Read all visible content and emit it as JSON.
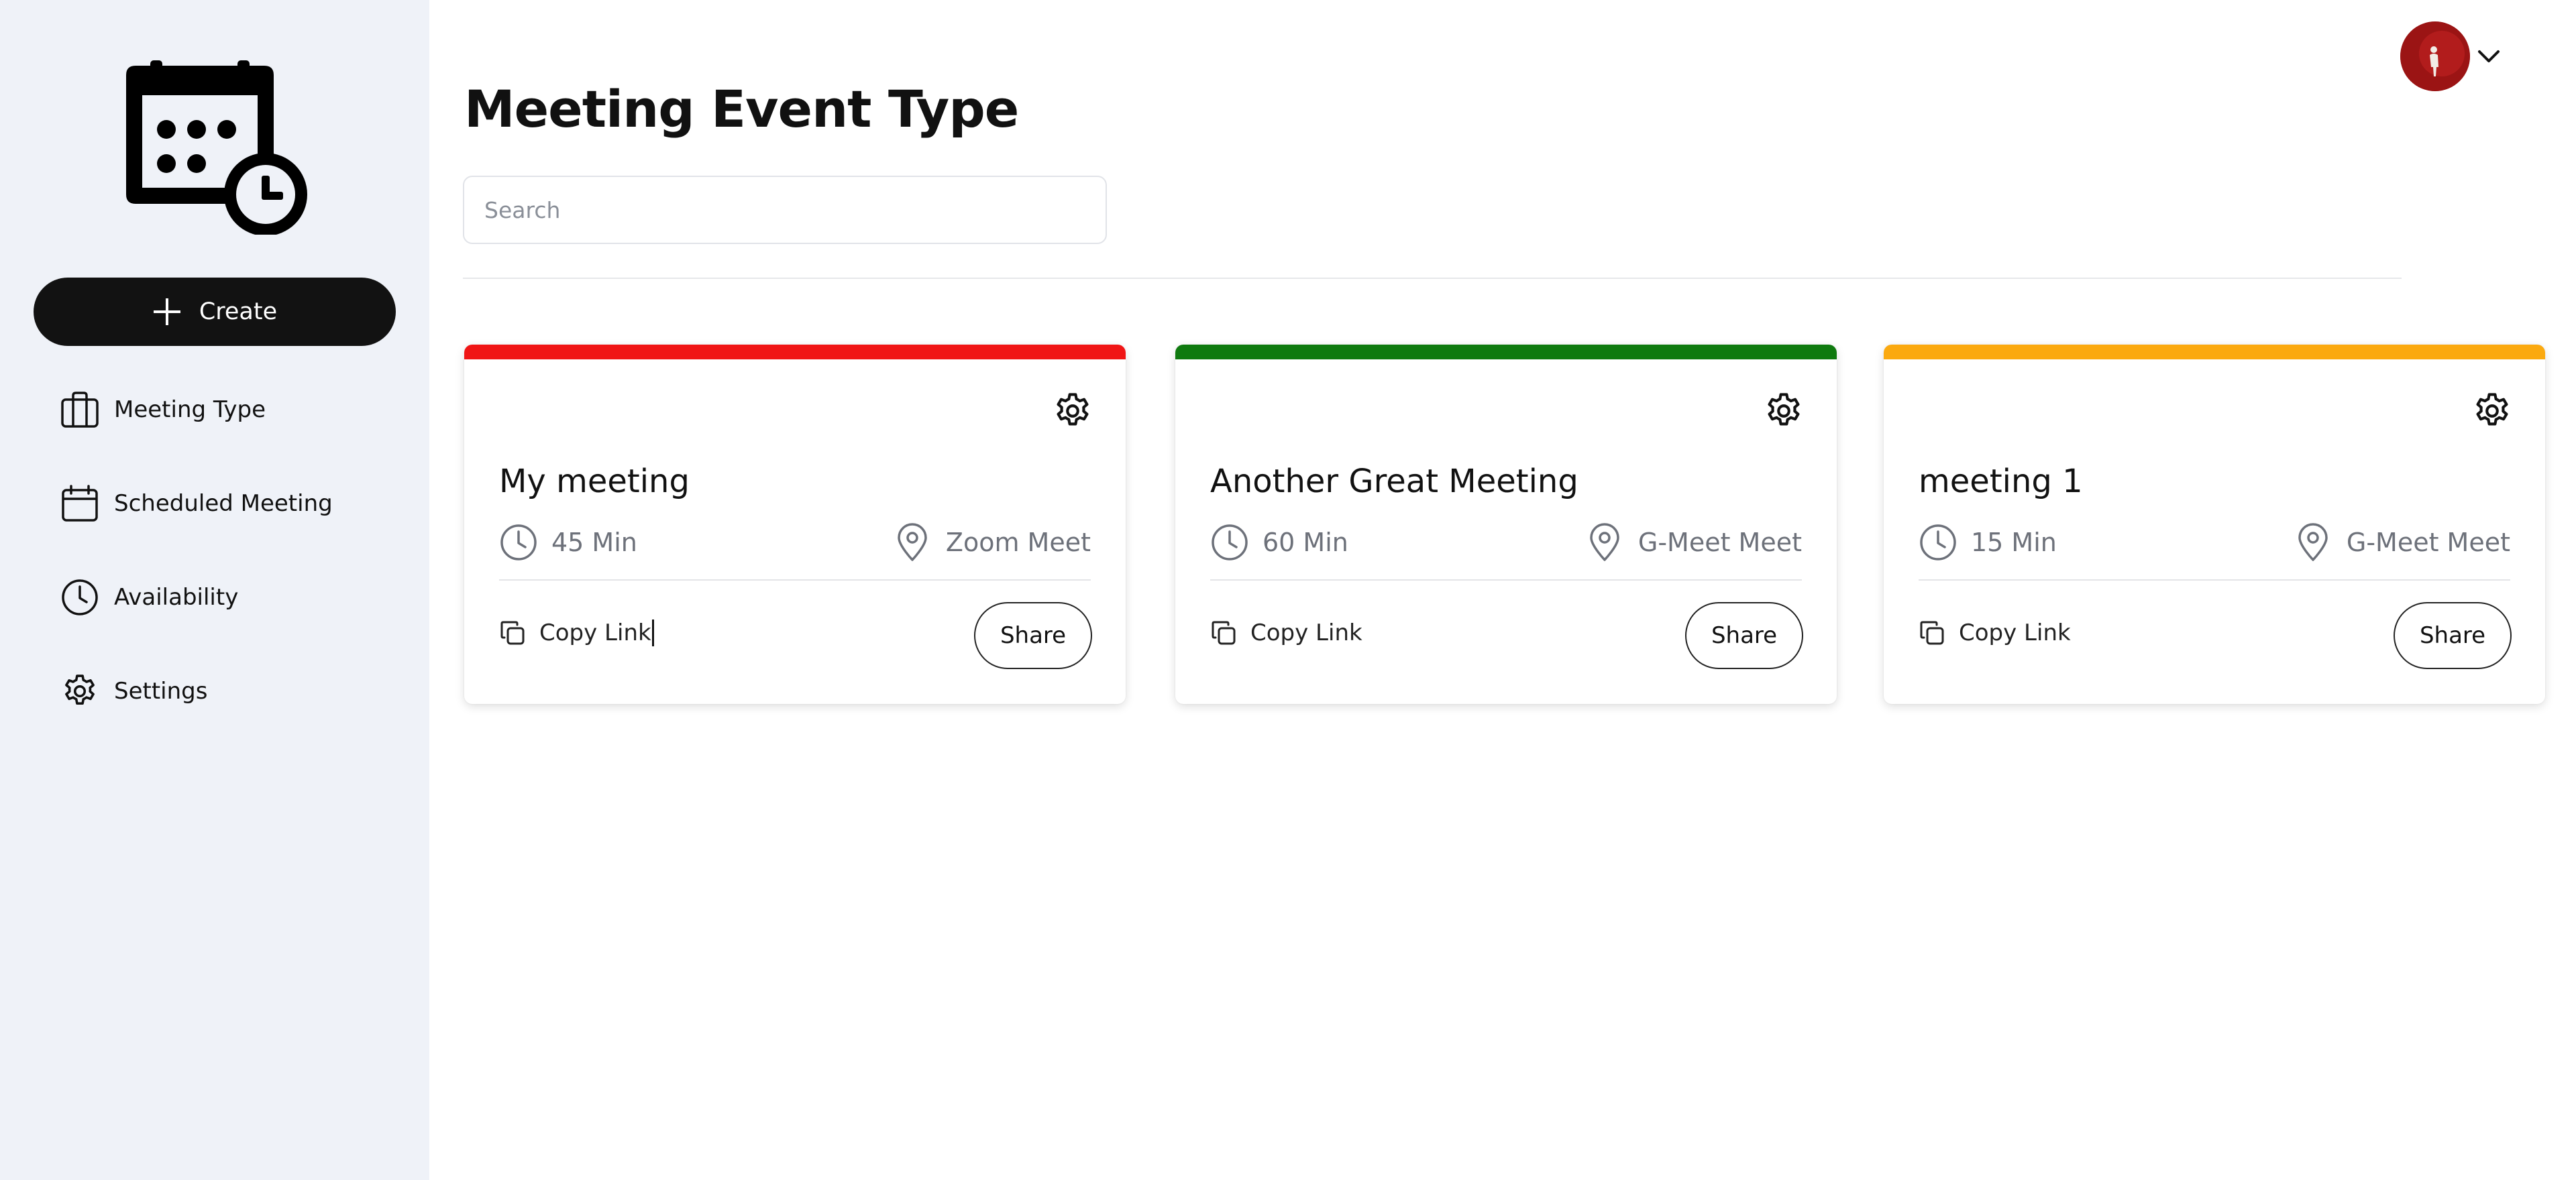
{
  "sidebar": {
    "create_label": "Create",
    "items": [
      {
        "label": "Meeting Type",
        "icon": "briefcase-icon"
      },
      {
        "label": "Scheduled Meeting",
        "icon": "calendar-icon"
      },
      {
        "label": "Availability",
        "icon": "clock-icon"
      },
      {
        "label": "Settings",
        "icon": "gear-icon"
      }
    ]
  },
  "header": {
    "title": "Meeting Event Type",
    "search_placeholder": "Search"
  },
  "cards": [
    {
      "title": "My meeting",
      "duration": "45 Min",
      "location": "Zoom Meet",
      "copy_label": "Copy Link",
      "share_label": "Share",
      "accent": "#f01515"
    },
    {
      "title": "Another Great Meeting",
      "duration": "60 Min",
      "location": "G-Meet Meet",
      "copy_label": "Copy Link",
      "share_label": "Share",
      "accent": "#0f7a0f"
    },
    {
      "title": "meeting 1",
      "duration": "15 Min",
      "location": "G-Meet Meet",
      "copy_label": "Copy Link",
      "share_label": "Share",
      "accent": "#fba90f"
    }
  ],
  "colors": {
    "sidebar_bg": "#eff2f8",
    "primary": "#121212",
    "avatar_bg": "#9b1414"
  }
}
